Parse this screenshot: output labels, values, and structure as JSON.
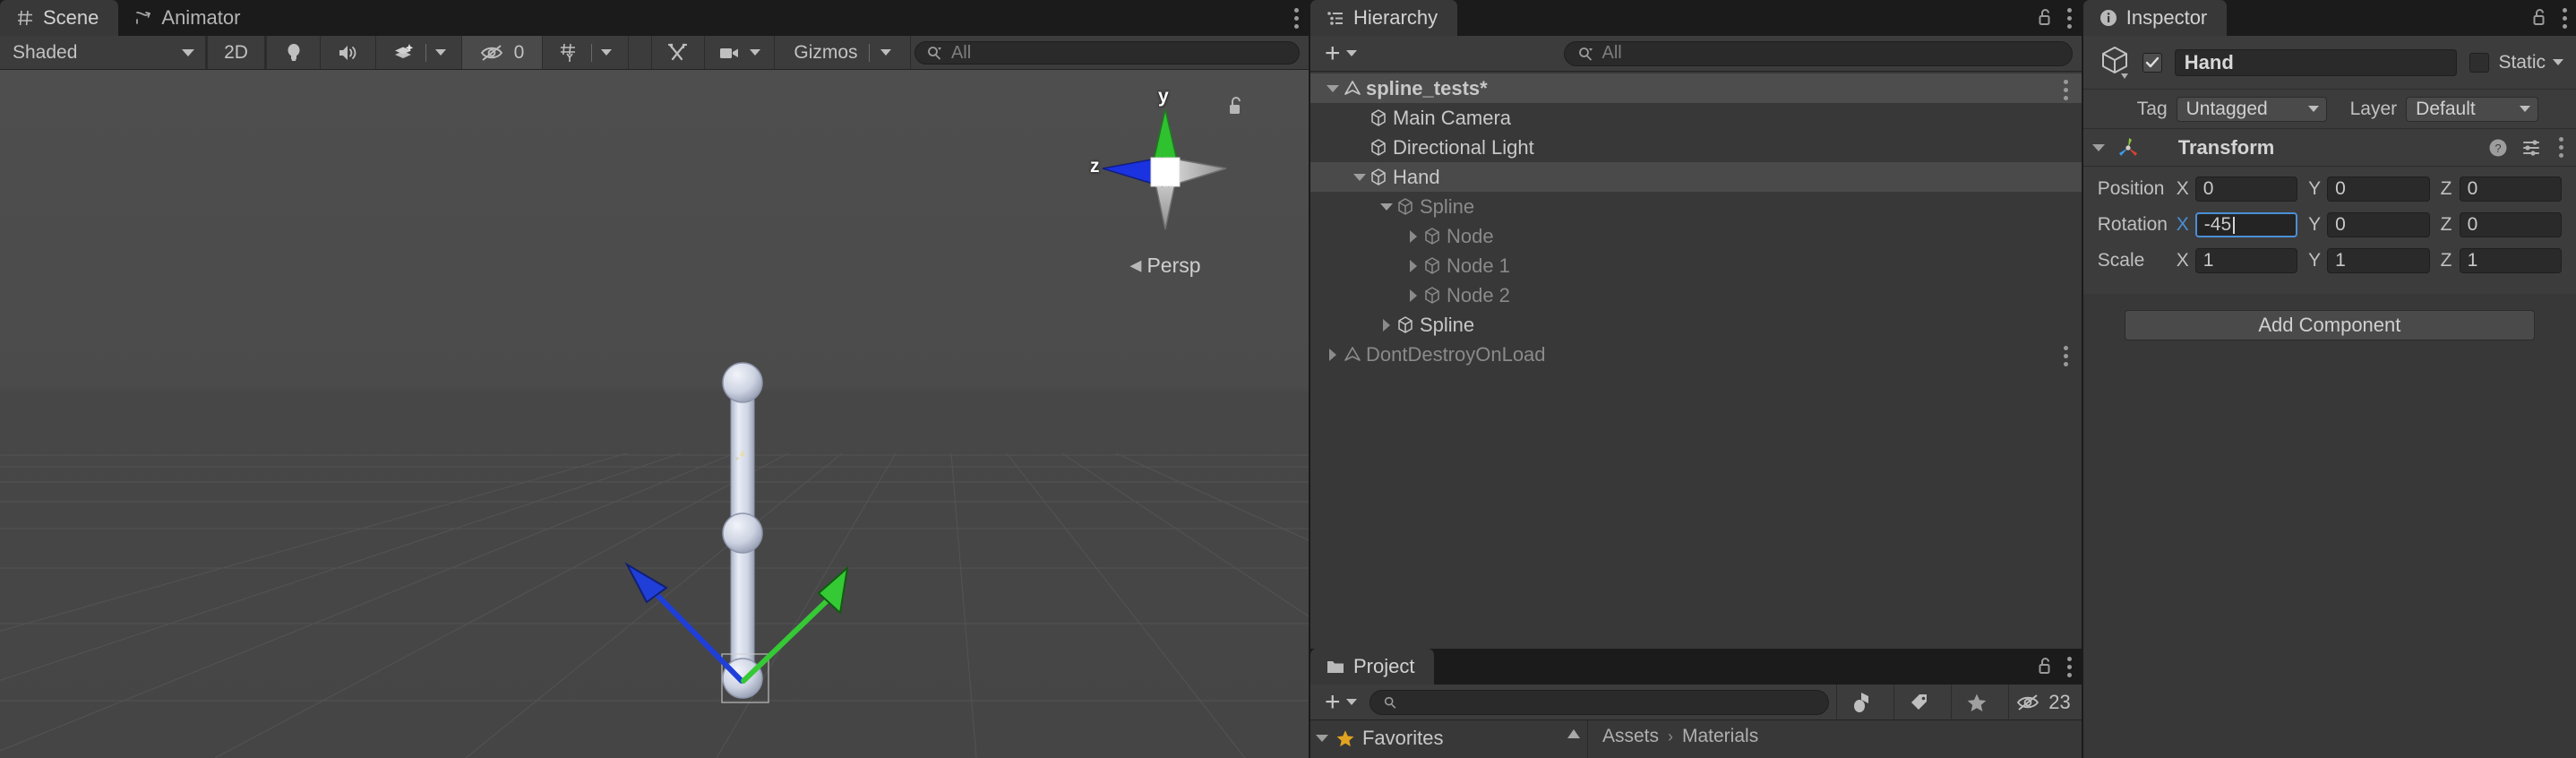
{
  "scene_panel": {
    "tabs": [
      {
        "label": "Scene",
        "icon": "grid-hash-icon",
        "active": true
      },
      {
        "label": "Animator",
        "icon": "animator-icon",
        "active": false
      }
    ],
    "toolbar": {
      "shading_mode": "Shaded",
      "mode_2d": "2D",
      "lighting_icon": "lightbulb-icon",
      "audio_icon": "speaker-icon",
      "fx_icon": "effects-layers-icon",
      "hidden_objects_icon": "eye-off-icon",
      "hidden_objects_count": "0",
      "grid_icon": "grid-axis-y-icon",
      "tools_icon": "tools-icon",
      "camera_icon": "scene-camera-icon",
      "gizmos_label": "Gizmos",
      "search_placeholder": "All",
      "search_value": ""
    },
    "viewport": {
      "axis_gizmo": {
        "y_label": "y",
        "z_label": "z",
        "projection": "Persp",
        "lock_icon": "lock-open-icon",
        "y_axis_color": "#2fc12f",
        "z_axis_color": "#1b32e0",
        "center_color": "#ffffff",
        "inactive_cone_color": "#b0b0b0"
      },
      "gizmo_arrows": {
        "green_axis_color": "#35c935",
        "blue_axis_color": "#1f3fd8",
        "node_color": "#cfd5e8"
      }
    }
  },
  "hierarchy_panel": {
    "tab_label": "Hierarchy",
    "tab_icon": "hierarchy-list-icon",
    "lock_icon": "lock-open-icon",
    "menu_icon": "kebab-menu-icon",
    "create_label": "+",
    "search_placeholder": "All",
    "search_value": "",
    "items": [
      {
        "label": "spline_tests*",
        "depth": 0,
        "twisty": "down",
        "icon": "scene-icon",
        "state": "scene-root",
        "kebab": true
      },
      {
        "label": "Main Camera",
        "depth": 1,
        "twisty": "none",
        "icon": "gameobject-icon",
        "state": "normal",
        "kebab": false
      },
      {
        "label": "Directional Light",
        "depth": 1,
        "twisty": "none",
        "icon": "gameobject-icon",
        "state": "normal",
        "kebab": false
      },
      {
        "label": "Hand",
        "depth": 1,
        "twisty": "down",
        "icon": "gameobject-icon",
        "state": "selected",
        "kebab": false
      },
      {
        "label": "Spline",
        "depth": 2,
        "twisty": "down",
        "icon": "gameobject-icon",
        "state": "dim",
        "kebab": false
      },
      {
        "label": "Node",
        "depth": 3,
        "twisty": "right",
        "icon": "gameobject-icon",
        "state": "dim",
        "kebab": false
      },
      {
        "label": "Node 1",
        "depth": 3,
        "twisty": "right",
        "icon": "gameobject-icon",
        "state": "dim",
        "kebab": false
      },
      {
        "label": "Node 2",
        "depth": 3,
        "twisty": "right",
        "icon": "gameobject-icon",
        "state": "dim",
        "kebab": false
      },
      {
        "label": "Spline",
        "depth": 2,
        "twisty": "right",
        "icon": "gameobject-icon",
        "state": "normal",
        "kebab": false
      },
      {
        "label": "DontDestroyOnLoad",
        "depth": 0,
        "twisty": "right",
        "icon": "scene-icon",
        "state": "dim",
        "kebab": true
      }
    ]
  },
  "project_panel": {
    "tab_label": "Project",
    "tab_icon": "folder-icon",
    "lock_icon": "lock-open-icon",
    "menu_icon": "kebab-menu-icon",
    "create_label": "+",
    "search_placeholder": "",
    "search_value": "",
    "filter_type_icon": "asset-type-filter-icon",
    "filter_label_icon": "tag-filter-icon",
    "filter_favorite_icon": "star-filter-icon",
    "hidden_count_icon": "eye-off-icon",
    "hidden_count": "23",
    "favorites_label": "Favorites",
    "favorites_star_icon": "star-icon",
    "breadcrumb": [
      "Assets",
      "Materials"
    ],
    "breadcrumb_separator": "›"
  },
  "inspector_panel": {
    "tab_label": "Inspector",
    "tab_icon": "info-circle-icon",
    "lock_icon": "lock-open-icon",
    "menu_icon": "kebab-menu-icon",
    "accent_color": "#4a7ba8",
    "gameobject": {
      "icon": "gameobject-cube-icon",
      "enabled": true,
      "name": "Hand",
      "static_checked": false,
      "static_label": "Static",
      "tag_label": "Tag",
      "tag_value": "Untagged",
      "layer_label": "Layer",
      "layer_value": "Default"
    },
    "transform": {
      "title": "Transform",
      "icon": "transform-axes-icon",
      "help_icon": "help-circle-icon",
      "preset_icon": "preset-sliders-icon",
      "menu_icon": "kebab-menu-icon",
      "rows": [
        {
          "label": "Position",
          "fields": [
            {
              "axis": "X",
              "value": "0",
              "focused": false
            },
            {
              "axis": "Y",
              "value": "0",
              "focused": false
            },
            {
              "axis": "Z",
              "value": "0",
              "focused": false
            }
          ]
        },
        {
          "label": "Rotation",
          "fields": [
            {
              "axis": "X",
              "value": "-45",
              "focused": true
            },
            {
              "axis": "Y",
              "value": "0",
              "focused": false
            },
            {
              "axis": "Z",
              "value": "0",
              "focused": false
            }
          ]
        },
        {
          "label": "Scale",
          "fields": [
            {
              "axis": "X",
              "value": "1",
              "focused": false
            },
            {
              "axis": "Y",
              "value": "1",
              "focused": false
            },
            {
              "axis": "Z",
              "value": "1",
              "focused": false
            }
          ]
        }
      ]
    },
    "add_component_label": "Add Component"
  }
}
